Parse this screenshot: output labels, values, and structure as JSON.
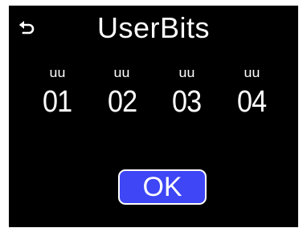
{
  "window": {
    "title": "UserBits"
  },
  "header": {
    "back_icon": "back-arrow-icon"
  },
  "bits": [
    {
      "label": "uu",
      "value": "01"
    },
    {
      "label": "uu",
      "value": "02"
    },
    {
      "label": "uu",
      "value": "03"
    },
    {
      "label": "uu",
      "value": "04"
    }
  ],
  "actions": {
    "ok_label": "OK"
  },
  "colors": {
    "background": "#000000",
    "text": "#ffffff",
    "ok_button": "#3e46f5"
  }
}
